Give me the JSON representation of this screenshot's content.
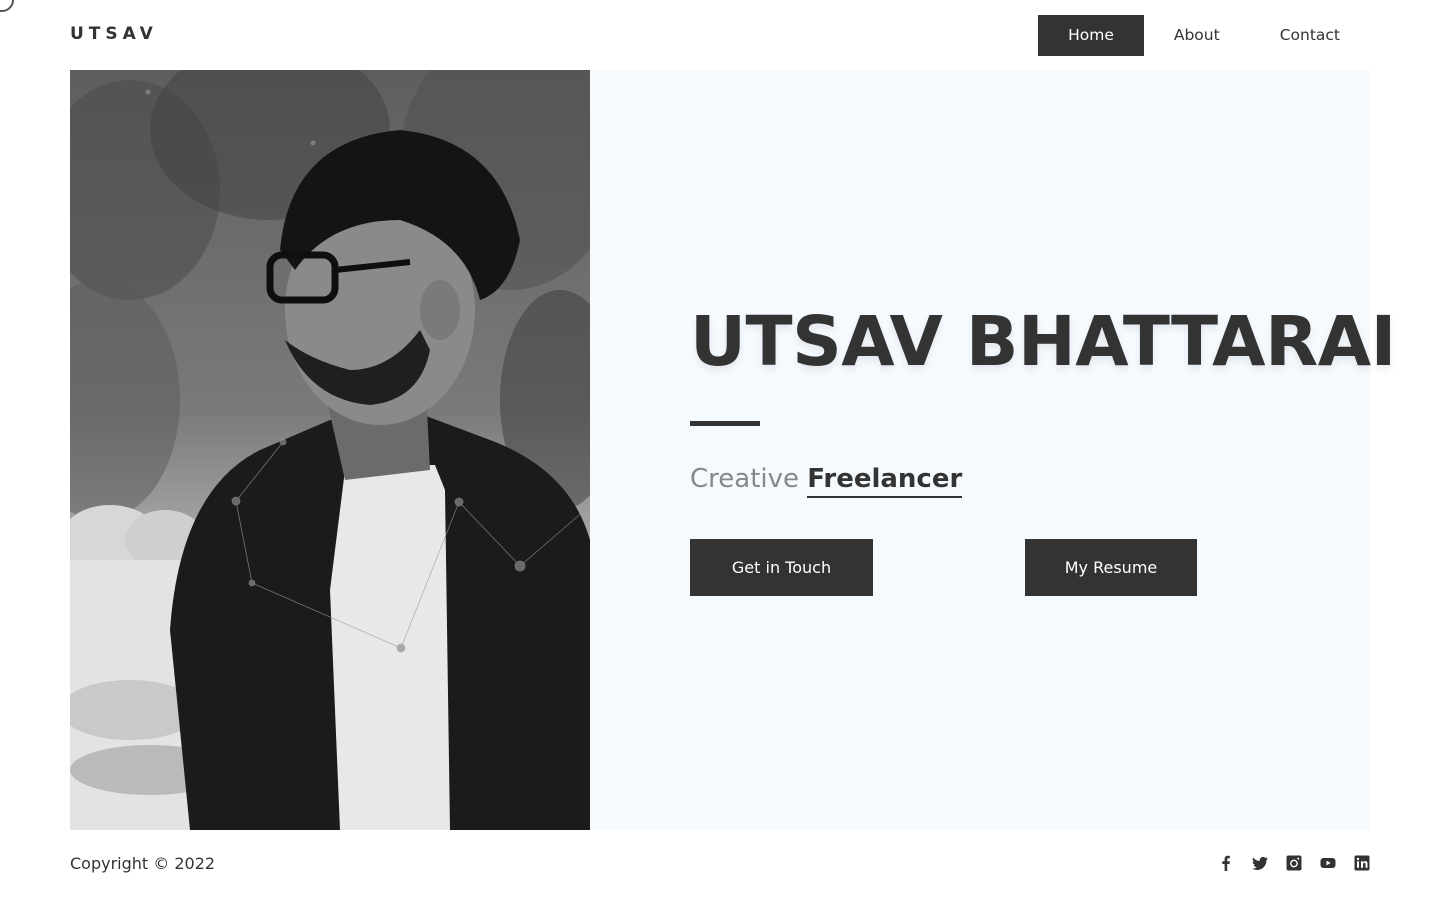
{
  "brand": {
    "logo": "UTSAV"
  },
  "nav": {
    "items": [
      {
        "label": "Home",
        "active": true
      },
      {
        "label": "About",
        "active": false
      },
      {
        "label": "Contact",
        "active": false
      }
    ]
  },
  "hero": {
    "name": "UTSAV BHATTARAI",
    "tagline_light": "Creative",
    "tagline_strong": "Freelancer",
    "buttons": {
      "contact": "Get in Touch",
      "resume": "My Resume"
    }
  },
  "footer": {
    "copyright": "Copyright © 2022",
    "socials": [
      "facebook-icon",
      "twitter-icon",
      "instagram-icon",
      "youtube-icon",
      "linkedin-icon"
    ]
  },
  "colors": {
    "primary": "#333333",
    "hero_bg": "#f5faff",
    "muted_text": "#888888",
    "page_bg": "#ffffff"
  }
}
